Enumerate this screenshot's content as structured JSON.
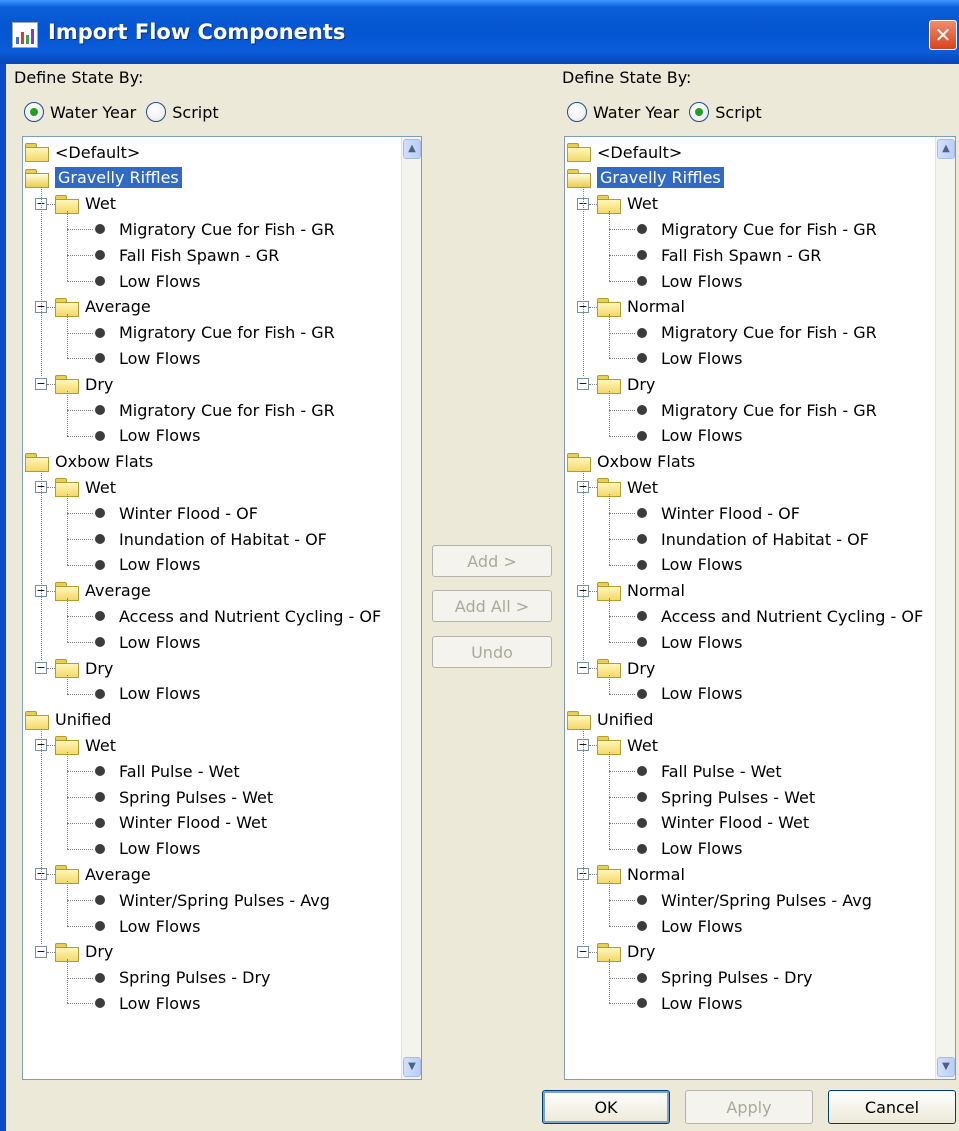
{
  "window": {
    "title": "Import Flow Components",
    "close_glyph": "✕",
    "icon": "chart-app-icon"
  },
  "left_panel": {
    "define_label": "Define State By:",
    "options": [
      {
        "label": "Water Year",
        "checked": true
      },
      {
        "label": "Script",
        "checked": false
      }
    ],
    "tree": [
      {
        "label": "<Default>",
        "type": "folder",
        "level": 0
      },
      {
        "label": "Gravelly Riffles",
        "type": "folder",
        "level": 0,
        "selected": true,
        "open": true
      },
      {
        "label": "Wet",
        "type": "folder",
        "level": 1,
        "expanded": true
      },
      {
        "label": "Migratory Cue for Fish - GR",
        "type": "leaf",
        "level": 2
      },
      {
        "label": "Fall Fish Spawn - GR",
        "type": "leaf",
        "level": 2
      },
      {
        "label": "Low Flows",
        "type": "leaf",
        "level": 2
      },
      {
        "label": "Average",
        "type": "folder",
        "level": 1,
        "expanded": true
      },
      {
        "label": "Migratory Cue for Fish - GR",
        "type": "leaf",
        "level": 2
      },
      {
        "label": "Low Flows",
        "type": "leaf",
        "level": 2
      },
      {
        "label": "Dry",
        "type": "folder",
        "level": 1,
        "expanded": true
      },
      {
        "label": "Migratory Cue for Fish - GR",
        "type": "leaf",
        "level": 2
      },
      {
        "label": "Low Flows",
        "type": "leaf",
        "level": 2
      },
      {
        "label": "Oxbow Flats",
        "type": "folder",
        "level": 0
      },
      {
        "label": "Wet",
        "type": "folder",
        "level": 1,
        "expanded": true
      },
      {
        "label": "Winter Flood - OF",
        "type": "leaf",
        "level": 2
      },
      {
        "label": "Inundation of Habitat - OF",
        "type": "leaf",
        "level": 2
      },
      {
        "label": "Low Flows",
        "type": "leaf",
        "level": 2
      },
      {
        "label": "Average",
        "type": "folder",
        "level": 1,
        "expanded": true
      },
      {
        "label": "Access and Nutrient Cycling - OF",
        "type": "leaf",
        "level": 2
      },
      {
        "label": "Low Flows",
        "type": "leaf",
        "level": 2
      },
      {
        "label": "Dry",
        "type": "folder",
        "level": 1,
        "expanded": true
      },
      {
        "label": "Low Flows",
        "type": "leaf",
        "level": 2
      },
      {
        "label": "Unified",
        "type": "folder",
        "level": 0
      },
      {
        "label": "Wet",
        "type": "folder",
        "level": 1,
        "expanded": true
      },
      {
        "label": "Fall Pulse - Wet",
        "type": "leaf",
        "level": 2
      },
      {
        "label": "Spring Pulses - Wet",
        "type": "leaf",
        "level": 2
      },
      {
        "label": "Winter Flood - Wet",
        "type": "leaf",
        "level": 2
      },
      {
        "label": "Low Flows",
        "type": "leaf",
        "level": 2
      },
      {
        "label": "Average",
        "type": "folder",
        "level": 1,
        "expanded": true
      },
      {
        "label": "Winter/Spring Pulses - Avg",
        "type": "leaf",
        "level": 2
      },
      {
        "label": "Low Flows",
        "type": "leaf",
        "level": 2
      },
      {
        "label": "Dry",
        "type": "folder",
        "level": 1,
        "expanded": true
      },
      {
        "label": "Spring Pulses - Dry",
        "type": "leaf",
        "level": 2
      },
      {
        "label": "Low Flows",
        "type": "leaf",
        "level": 2
      }
    ]
  },
  "right_panel": {
    "define_label": "Define State By:",
    "options": [
      {
        "label": "Water Year",
        "checked": false
      },
      {
        "label": "Script",
        "checked": true
      }
    ],
    "tree": [
      {
        "label": "<Default>",
        "type": "folder",
        "level": 0
      },
      {
        "label": "Gravelly Riffles",
        "type": "folder",
        "level": 0,
        "selected": true,
        "open": true
      },
      {
        "label": "Wet",
        "type": "folder",
        "level": 1,
        "expanded": true
      },
      {
        "label": "Migratory Cue for Fish - GR",
        "type": "leaf",
        "level": 2
      },
      {
        "label": "Fall Fish Spawn - GR",
        "type": "leaf",
        "level": 2
      },
      {
        "label": "Low Flows",
        "type": "leaf",
        "level": 2
      },
      {
        "label": "Normal",
        "type": "folder",
        "level": 1,
        "expanded": true
      },
      {
        "label": "Migratory Cue for Fish - GR",
        "type": "leaf",
        "level": 2
      },
      {
        "label": "Low Flows",
        "type": "leaf",
        "level": 2
      },
      {
        "label": "Dry",
        "type": "folder",
        "level": 1,
        "expanded": true
      },
      {
        "label": "Migratory Cue for Fish - GR",
        "type": "leaf",
        "level": 2
      },
      {
        "label": "Low Flows",
        "type": "leaf",
        "level": 2
      },
      {
        "label": "Oxbow Flats",
        "type": "folder",
        "level": 0
      },
      {
        "label": "Wet",
        "type": "folder",
        "level": 1,
        "expanded": true
      },
      {
        "label": "Winter Flood - OF",
        "type": "leaf",
        "level": 2
      },
      {
        "label": "Inundation of Habitat - OF",
        "type": "leaf",
        "level": 2
      },
      {
        "label": "Low Flows",
        "type": "leaf",
        "level": 2
      },
      {
        "label": "Normal",
        "type": "folder",
        "level": 1,
        "expanded": true
      },
      {
        "label": "Access and Nutrient Cycling - OF",
        "type": "leaf",
        "level": 2
      },
      {
        "label": "Low Flows",
        "type": "leaf",
        "level": 2
      },
      {
        "label": "Dry",
        "type": "folder",
        "level": 1,
        "expanded": true
      },
      {
        "label": "Low Flows",
        "type": "leaf",
        "level": 2
      },
      {
        "label": "Unified",
        "type": "folder",
        "level": 0
      },
      {
        "label": "Wet",
        "type": "folder",
        "level": 1,
        "expanded": true
      },
      {
        "label": "Fall Pulse - Wet",
        "type": "leaf",
        "level": 2
      },
      {
        "label": "Spring Pulses - Wet",
        "type": "leaf",
        "level": 2
      },
      {
        "label": "Winter Flood - Wet",
        "type": "leaf",
        "level": 2
      },
      {
        "label": "Low Flows",
        "type": "leaf",
        "level": 2
      },
      {
        "label": "Normal",
        "type": "folder",
        "level": 1,
        "expanded": true
      },
      {
        "label": "Winter/Spring Pulses - Avg",
        "type": "leaf",
        "level": 2
      },
      {
        "label": "Low Flows",
        "type": "leaf",
        "level": 2
      },
      {
        "label": "Dry",
        "type": "folder",
        "level": 1,
        "expanded": true
      },
      {
        "label": "Spring Pulses - Dry",
        "type": "leaf",
        "level": 2
      },
      {
        "label": "Low Flows",
        "type": "leaf",
        "level": 2
      }
    ]
  },
  "middle_buttons": {
    "add": "Add >",
    "add_all": "Add All >",
    "undo": "Undo"
  },
  "footer_buttons": {
    "ok": "OK",
    "apply": "Apply",
    "cancel": "Cancel"
  },
  "scroll": {
    "up_glyph": "▲",
    "down_glyph": "▼"
  },
  "colors": {
    "titlebar": "#0554d0",
    "selection": "#316ac5",
    "close": "#d8431c"
  }
}
